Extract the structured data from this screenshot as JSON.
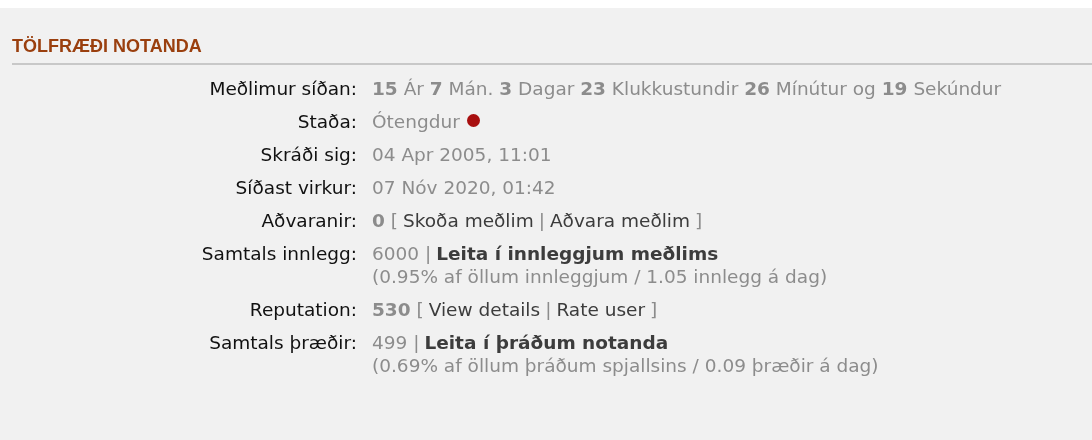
{
  "section": {
    "title": "TÖLFRÆÐI NOTANDA"
  },
  "rows": [
    {
      "label": "Meðlimur síðan:",
      "parts": [
        {
          "kind": "text",
          "text": "**15** Ár **7** Mán. **3** Dagar **23** Klukkustundir **26** Mínútur og **19** Sekúndur"
        }
      ]
    },
    {
      "label": "Staða:",
      "parts": [
        {
          "kind": "text",
          "text": "Ótengdur"
        },
        {
          "kind": "dot",
          "color": "#a80f0f"
        }
      ]
    },
    {
      "label": "Skráði sig:",
      "parts": [
        {
          "kind": "text",
          "text": "04 Apr 2005, 11:01"
        }
      ]
    },
    {
      "label": "Síðast virkur:",
      "parts": [
        {
          "kind": "text",
          "text": "07 Nóv 2020, 01:42"
        }
      ]
    },
    {
      "label": "Aðvaranir:",
      "parts": [
        {
          "kind": "text",
          "text": "**0** ["
        },
        {
          "kind": "link",
          "text": "Skoða meðlim"
        },
        {
          "kind": "text",
          "text": "|"
        },
        {
          "kind": "link",
          "text": "Aðvara meðlim"
        },
        {
          "kind": "text",
          "text": "]"
        }
      ]
    },
    {
      "label": "Samtals innlegg:",
      "parts": [
        {
          "kind": "text",
          "text": "6000 |"
        },
        {
          "kind": "strong-link",
          "text": "Leita í innleggjum meðlims"
        },
        {
          "kind": "note",
          "text": "(0.95% af öllum innleggjum / 1.05 innlegg á dag)"
        }
      ]
    },
    {
      "label": "Reputation:",
      "parts": [
        {
          "kind": "text",
          "text": "**530** ["
        },
        {
          "kind": "link",
          "text": "View details"
        },
        {
          "kind": "text",
          "text": "|"
        },
        {
          "kind": "link",
          "text": "Rate user"
        },
        {
          "kind": "text",
          "text": "]"
        }
      ]
    },
    {
      "label": "Samtals þræðir:",
      "parts": [
        {
          "kind": "text",
          "text": "499 |"
        },
        {
          "kind": "strong-link",
          "text": "Leita í þráðum notanda"
        },
        {
          "kind": "note",
          "text": "(0.69% af öllum þráðum spjallsins / 0.09 þræðir á dag)"
        }
      ]
    }
  ]
}
